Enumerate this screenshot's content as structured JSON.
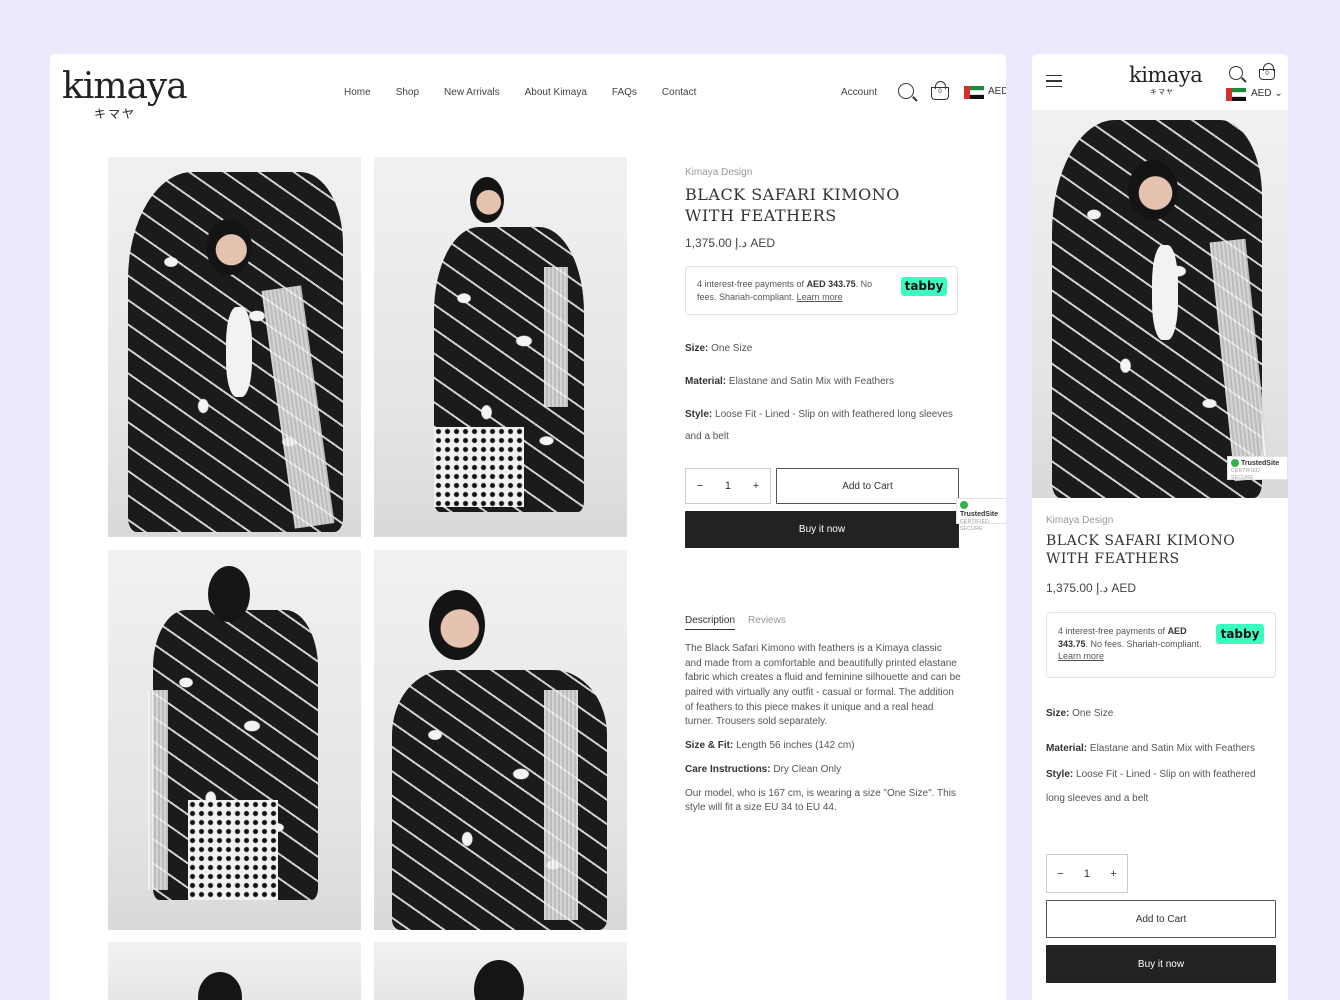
{
  "brand": {
    "name": "kimaya",
    "subtitle": "キマヤ"
  },
  "nav": [
    "Home",
    "Shop",
    "New Arrivals",
    "About Kimaya",
    "FAQs",
    "Contact"
  ],
  "header": {
    "account": "Account",
    "cart_count": "0",
    "currency": "AED",
    "currency_mobile": "AED ⌄"
  },
  "product": {
    "vendor": "Kimaya Design",
    "title": "BLACK SAFARI KIMONO WITH FEATHERS",
    "price": "1,375.00 د.إ AED"
  },
  "tabby": {
    "prefix": "4 interest-free payments of ",
    "amount": "AED 343.75",
    "suffix": ". No fees. Shariah-compliant. ",
    "link": "Learn more",
    "badge": "tabby"
  },
  "specs": {
    "size_label": "Size:",
    "size_value": " One Size",
    "material_label": "Material:",
    "material_value": " Elastane and Satin Mix with Feathers",
    "style_label": "Style:",
    "style_value": " Loose Fit - Lined - Slip on with feathered long sleeves and a belt"
  },
  "cart": {
    "minus": "−",
    "qty": "1",
    "plus": "+",
    "add_to_cart": "Add to Cart",
    "buy_now": "Buy it now"
  },
  "trusted": {
    "title": "TrustedSite",
    "sub": "CERTIFIED SECURE"
  },
  "tabs": [
    "Description",
    "Reviews"
  ],
  "description": {
    "body": "The Black Safari Kimono with feathers is a Kimaya classic and made from a comfortable and beautifully printed elastane fabric which creates a fluid and feminine silhouette and can be paired with virtually any outfit - casual or formal. The addition of feathers to this piece makes it unique and a real head turner. Trousers sold separately.",
    "fit_label": "Size & Fit:",
    "fit_value": " Length 56 inches (142 cm)",
    "care_label": "Care Instructions:",
    "care_value": " Dry Clean Only",
    "model": "Our model, who is 167 cm, is wearing a size \"One Size\". This style will fit a size EU 34 to EU 44."
  },
  "colors": {
    "dark_button": "#222222",
    "tabby_green": "#3bffc1",
    "background": "#ebe9fb"
  }
}
